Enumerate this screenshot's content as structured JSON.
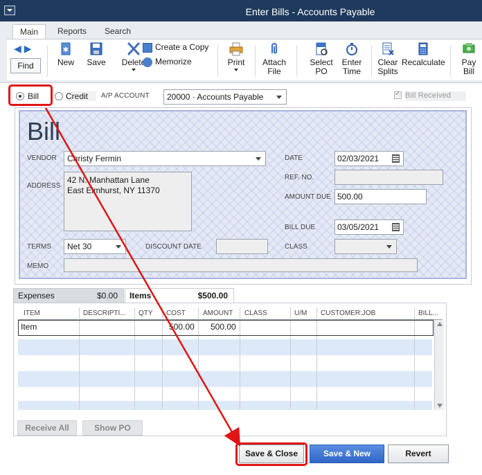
{
  "window": {
    "title": "Enter Bills - Accounts Payable"
  },
  "ribbon": {
    "tabs": [
      {
        "label": "Main"
      },
      {
        "label": "Reports"
      },
      {
        "label": "Search"
      }
    ],
    "find_label": "Find",
    "tools": {
      "new": "New",
      "save": "Save",
      "delete": "Delete",
      "create_copy": "Create a Copy",
      "memorize": "Memorize",
      "print": "Print",
      "attach_file": [
        "Attach",
        "File"
      ],
      "select_po": [
        "Select",
        "PO"
      ],
      "enter_time": [
        "Enter",
        "Time"
      ],
      "clear_splits": [
        "Clear",
        "Splits"
      ],
      "recalculate": "Recalculate",
      "pay_bill": [
        "Pay",
        "Bill"
      ]
    }
  },
  "options": {
    "bill_label": "Bill",
    "credit_label": "Credit",
    "ap_account_label": "A/P ACCOUNT",
    "ap_account_value": "20000 · Accounts Payable",
    "bill_received_label": "Bill Received"
  },
  "bill": {
    "title": "Bill",
    "vendor_label": "VENDOR",
    "vendor_value": "Christy Fermin",
    "address_label": "ADDRESS",
    "address_line1": "42 N. Manhattan Lane",
    "address_line2": "East Elmhurst, NY 11370",
    "date_label": "DATE",
    "date_value": "02/03/2021",
    "ref_no_label": "REF. NO.",
    "ref_no_value": "",
    "amount_due_label": "AMOUNT DUE",
    "amount_due_value": "500.00",
    "bill_due_label": "BILL DUE",
    "bill_due_value": "03/05/2021",
    "terms_label": "TERMS",
    "terms_value": "Net 30",
    "discount_date_label": "DISCOUNT DATE",
    "class_label": "CLASS",
    "memo_label": "MEMO"
  },
  "lines": {
    "expenses_tab": {
      "label": "Expenses",
      "amount": "$0.00"
    },
    "items_tab": {
      "label": "Items",
      "amount": "$500.00"
    },
    "columns": [
      "ITEM",
      "DESCRIPTI...",
      "QTY",
      "COST",
      "AMOUNT",
      "CLASS",
      "U/M",
      "CUSTOMER:JOB",
      "BILL..."
    ],
    "rows": [
      {
        "item": "Item",
        "cost": "500.00",
        "amount": "500.00"
      }
    ],
    "receive_all": "Receive All",
    "show_po": "Show PO"
  },
  "footer": {
    "save_close": "Save & Close",
    "save_new": "Save & New",
    "revert": "Revert"
  },
  "colors": {
    "highlight": "#e01414",
    "title_bar": "#1f3a5c",
    "primary_button": "#2f66c6"
  }
}
